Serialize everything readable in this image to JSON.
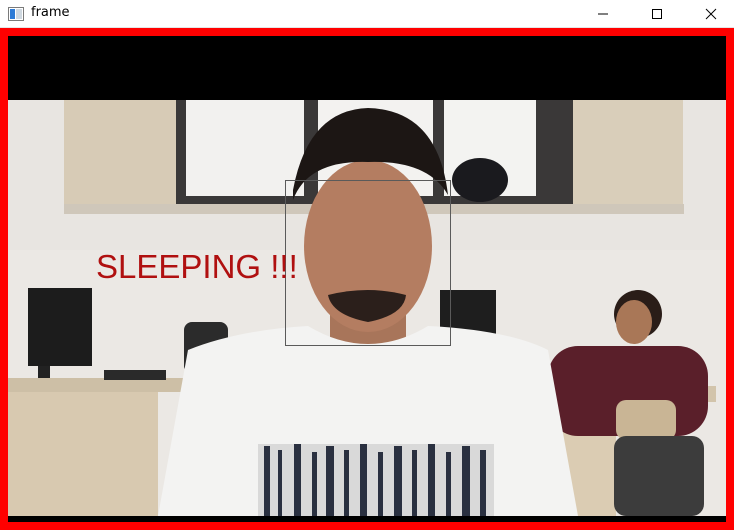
{
  "window": {
    "title": "frame",
    "icon": "opencv-window-icon",
    "controls": [
      "minimize-icon",
      "maximize-icon",
      "close-icon"
    ]
  },
  "overlay": {
    "status_text": "SLEEPING !!!",
    "status_color": "#b01010",
    "frame_border_color": "#ff0000",
    "face_box_color": "#5a5a5a"
  }
}
